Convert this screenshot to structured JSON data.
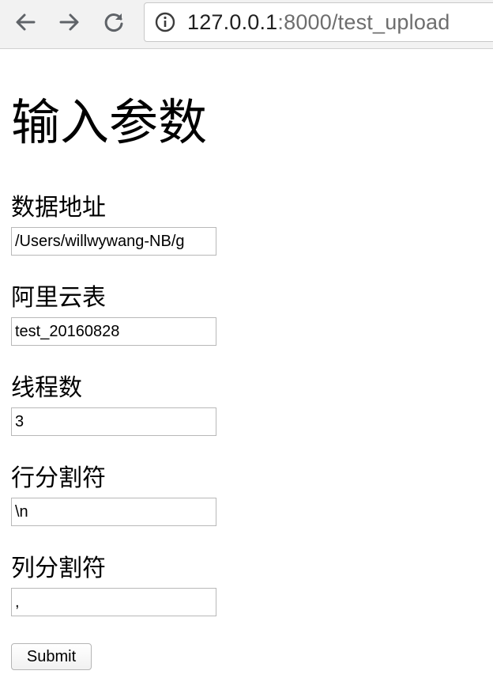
{
  "browser": {
    "url_host": "127.0.0.1",
    "url_rest": ":8000/test_upload",
    "icons": {
      "back": "arrow-left-icon",
      "forward": "arrow-right-icon",
      "reload": "reload-icon",
      "info": "info-icon"
    }
  },
  "page": {
    "heading": "输入参数",
    "fields": [
      {
        "label": "数据地址",
        "value": "/Users/willwywang-NB/g"
      },
      {
        "label": "阿里云表",
        "value": "test_20160828"
      },
      {
        "label": "线程数",
        "value": "3"
      },
      {
        "label": "行分割符",
        "value": "\\n"
      },
      {
        "label": "列分割符",
        "value": ","
      }
    ],
    "submit_label": "Submit"
  }
}
